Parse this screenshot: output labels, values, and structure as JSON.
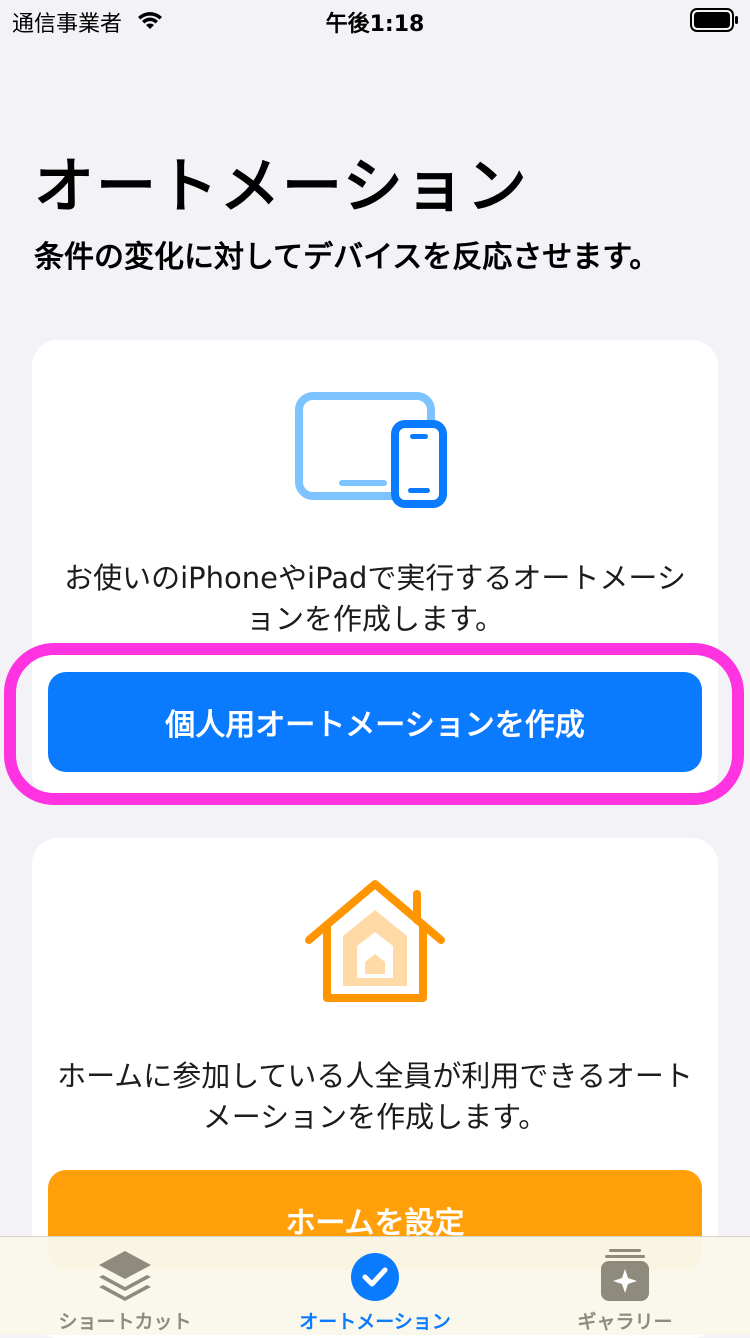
{
  "status_bar": {
    "carrier": "通信事業者",
    "time": "午後1:18"
  },
  "header": {
    "title": "オートメーション",
    "subtitle": "条件の変化に対してデバイスを反応させます。"
  },
  "personal_card": {
    "icon": "iphone-ipad-icon",
    "description": "お使いのiPhoneやiPadで実行するオートメーションを作成します。",
    "button_label": "個人用オートメーションを作成",
    "button_color": "#0a7aff"
  },
  "home_card": {
    "icon": "home-icon",
    "description": "ホームに参加している人全員が利用できるオートメーションを作成します。",
    "button_label": "ホームを設定",
    "button_color": "#ff9f0a"
  },
  "tab_bar": {
    "tabs": [
      {
        "label": "ショートカット",
        "icon": "layers-icon",
        "color": "#8e8a7c",
        "active": false
      },
      {
        "label": "オートメーション",
        "icon": "checkmark-circle-icon",
        "color": "#0a7aff",
        "active": true
      },
      {
        "label": "ギャラリー",
        "icon": "gallery-sparkle-icon",
        "color": "#8e8a7c",
        "active": false
      }
    ]
  },
  "highlight_color": "#ff33e0"
}
